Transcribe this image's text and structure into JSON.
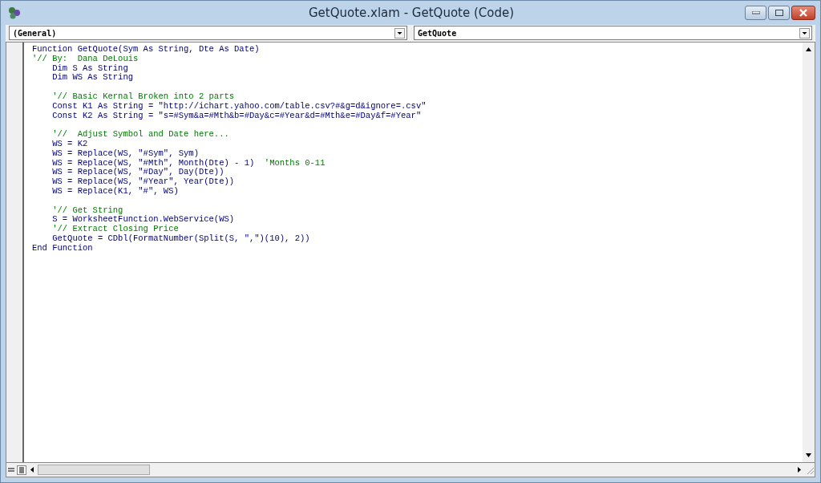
{
  "window": {
    "title": "GetQuote.xlam - GetQuote (Code)"
  },
  "object_dropdown": {
    "value": "(General)"
  },
  "procedure_dropdown": {
    "value": "GetQuote"
  },
  "code_lines": [
    {
      "kind": "text",
      "segments": [
        {
          "kind": "code",
          "text": "Function GetQuote(Sym As String, Dte As Date)"
        }
      ]
    },
    {
      "kind": "text",
      "segments": [
        {
          "kind": "comment",
          "text": "'// By:  Dana DeLouis"
        }
      ]
    },
    {
      "kind": "text",
      "segments": [
        {
          "kind": "code",
          "text": "    Dim S As String"
        }
      ]
    },
    {
      "kind": "text",
      "segments": [
        {
          "kind": "code",
          "text": "    Dim WS As String"
        }
      ]
    },
    {
      "kind": "blank"
    },
    {
      "kind": "text",
      "segments": [
        {
          "kind": "comment",
          "text": "    '// Basic Kernal Broken into 2 parts"
        }
      ]
    },
    {
      "kind": "text",
      "segments": [
        {
          "kind": "code",
          "text": "    Const K1 As String = \"http://ichart.yahoo.com/table.csv?#&g=d&ignore=.csv\""
        }
      ]
    },
    {
      "kind": "text",
      "segments": [
        {
          "kind": "code",
          "text": "    Const K2 As String = \"s=#Sym&a=#Mth&b=#Day&c=#Year&d=#Mth&e=#Day&f=#Year\""
        }
      ]
    },
    {
      "kind": "blank"
    },
    {
      "kind": "text",
      "segments": [
        {
          "kind": "comment",
          "text": "    '//  Adjust Symbol and Date here..."
        }
      ]
    },
    {
      "kind": "text",
      "segments": [
        {
          "kind": "code",
          "text": "    WS = K2"
        }
      ]
    },
    {
      "kind": "text",
      "segments": [
        {
          "kind": "code",
          "text": "    WS = Replace(WS, \"#Sym\", Sym)"
        }
      ]
    },
    {
      "kind": "text",
      "segments": [
        {
          "kind": "code",
          "text": "    WS = Replace(WS, \"#Mth\", Month(Dte) - 1)  "
        },
        {
          "kind": "comment",
          "text": "'Months 0-11"
        }
      ]
    },
    {
      "kind": "text",
      "segments": [
        {
          "kind": "code",
          "text": "    WS = Replace(WS, \"#Day\", Day(Dte))"
        }
      ]
    },
    {
      "kind": "text",
      "segments": [
        {
          "kind": "code",
          "text": "    WS = Replace(WS, \"#Year\", Year(Dte))"
        }
      ]
    },
    {
      "kind": "text",
      "segments": [
        {
          "kind": "code",
          "text": "    WS = Replace(K1, \"#\", WS)"
        }
      ]
    },
    {
      "kind": "blank"
    },
    {
      "kind": "text",
      "segments": [
        {
          "kind": "comment",
          "text": "    '// Get String"
        }
      ]
    },
    {
      "kind": "text",
      "segments": [
        {
          "kind": "code",
          "text": "    S = WorksheetFunction.WebService(WS)"
        }
      ]
    },
    {
      "kind": "text",
      "segments": [
        {
          "kind": "comment",
          "text": "    '// Extract Closing Price"
        }
      ]
    },
    {
      "kind": "text",
      "segments": [
        {
          "kind": "code",
          "text": "    GetQuote = CDbl(FormatNumber(Split(S, \",\")(10), 2))"
        }
      ]
    },
    {
      "kind": "text",
      "segments": [
        {
          "kind": "code",
          "text": "End Function"
        }
      ]
    }
  ]
}
